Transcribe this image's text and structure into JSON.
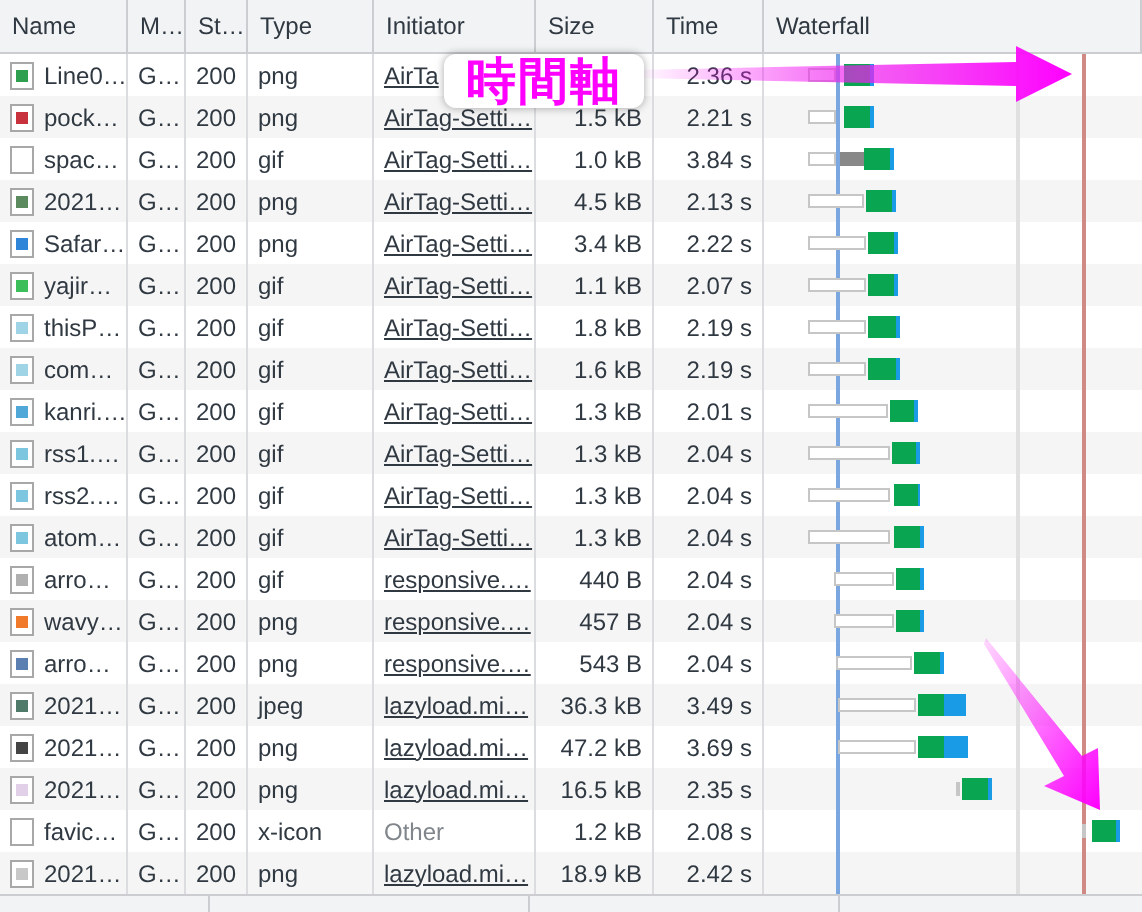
{
  "columns": [
    "Name",
    "M…",
    "St…",
    "Type",
    "Initiator",
    "Size",
    "Time",
    "Waterfall"
  ],
  "rows": [
    {
      "name": "Line0…",
      "method": "G…",
      "status": "200",
      "type": "png",
      "initiator": "AirTa",
      "link": true,
      "time": "2.36 s",
      "color": "#2e9e4f"
    },
    {
      "name": "pock…",
      "method": "G…",
      "status": "200",
      "type": "png",
      "initiator": "AirTag-Setti…",
      "link": true,
      "size": "1.5 kB",
      "time": "2.21 s",
      "color": "#c8323c"
    },
    {
      "name": "spac…",
      "method": "G…",
      "status": "200",
      "type": "gif",
      "initiator": "AirTag-Setti…",
      "link": true,
      "size": "1.0 kB",
      "time": "3.84 s",
      "color": "#ffffff"
    },
    {
      "name": "2021…",
      "method": "G…",
      "status": "200",
      "type": "png",
      "initiator": "AirTag-Setti…",
      "link": true,
      "size": "4.5 kB",
      "time": "2.13 s",
      "color": "#5a8a5e"
    },
    {
      "name": "Safar…",
      "method": "G…",
      "status": "200",
      "type": "png",
      "initiator": "AirTag-Setti…",
      "link": true,
      "size": "3.4 kB",
      "time": "2.22 s",
      "color": "#2f86d8"
    },
    {
      "name": "yajir…",
      "method": "G…",
      "status": "200",
      "type": "gif",
      "initiator": "AirTag-Setti…",
      "link": true,
      "size": "1.1 kB",
      "time": "2.07 s",
      "color": "#3cbf5a"
    },
    {
      "name": "thisP…",
      "method": "G…",
      "status": "200",
      "type": "gif",
      "initiator": "AirTag-Setti…",
      "link": true,
      "size": "1.8 kB",
      "time": "2.19 s",
      "color": "#9fd3e6"
    },
    {
      "name": "com…",
      "method": "G…",
      "status": "200",
      "type": "gif",
      "initiator": "AirTag-Setti…",
      "link": true,
      "size": "1.6 kB",
      "time": "2.19 s",
      "color": "#9fd3e6"
    },
    {
      "name": "kanri.…",
      "method": "G…",
      "status": "200",
      "type": "gif",
      "initiator": "AirTag-Setti…",
      "link": true,
      "size": "1.3 kB",
      "time": "2.01 s",
      "color": "#4fa8d8"
    },
    {
      "name": "rss1.…",
      "method": "G…",
      "status": "200",
      "type": "gif",
      "initiator": "AirTag-Setti…",
      "link": true,
      "size": "1.3 kB",
      "time": "2.04 s",
      "color": "#7cc6e0"
    },
    {
      "name": "rss2.…",
      "method": "G…",
      "status": "200",
      "type": "gif",
      "initiator": "AirTag-Setti…",
      "link": true,
      "size": "1.3 kB",
      "time": "2.04 s",
      "color": "#7cc6e0"
    },
    {
      "name": "atom…",
      "method": "G…",
      "status": "200",
      "type": "gif",
      "initiator": "AirTag-Setti…",
      "link": true,
      "size": "1.3 kB",
      "time": "2.04 s",
      "color": "#7cc6e0"
    },
    {
      "name": "arro…",
      "method": "G…",
      "status": "200",
      "type": "gif",
      "initiator": "responsive.…",
      "link": true,
      "size": "440 B",
      "time": "2.04 s",
      "color": "#b0b0b0"
    },
    {
      "name": "wavy…",
      "method": "G…",
      "status": "200",
      "type": "png",
      "initiator": "responsive.…",
      "link": true,
      "size": "457 B",
      "time": "2.04 s",
      "color": "#f07a2a"
    },
    {
      "name": "arro…",
      "method": "G…",
      "status": "200",
      "type": "png",
      "initiator": "responsive.…",
      "link": true,
      "size": "543 B",
      "time": "2.04 s",
      "color": "#5a7fb0"
    },
    {
      "name": "2021…",
      "method": "G…",
      "status": "200",
      "type": "jpeg",
      "initiator": "lazyload.mi…",
      "link": true,
      "size": "36.3 kB",
      "time": "3.49 s",
      "color": "#4f7a6a"
    },
    {
      "name": "2021…",
      "method": "G…",
      "status": "200",
      "type": "png",
      "initiator": "lazyload.mi…",
      "link": true,
      "size": "47.2 kB",
      "time": "3.69 s",
      "color": "#444444"
    },
    {
      "name": "2021…",
      "method": "G…",
      "status": "200",
      "type": "png",
      "initiator": "lazyload.mi…",
      "link": true,
      "size": "16.5 kB",
      "time": "2.35 s",
      "color": "#e2cfe8"
    },
    {
      "name": "favic…",
      "method": "G…",
      "status": "200",
      "type": "x-icon",
      "initiator": "Other",
      "link": false,
      "size": "1.2 kB",
      "time": "2.08 s",
      "color": "#ffffff"
    },
    {
      "name": "2021…",
      "method": "G…",
      "status": "200",
      "type": "png",
      "initiator": "lazyload.mi…",
      "link": true,
      "size": "18.9 kB",
      "time": "2.42 s",
      "color": "#c8c8c8"
    }
  ],
  "annotation": {
    "label": "時間軸"
  }
}
